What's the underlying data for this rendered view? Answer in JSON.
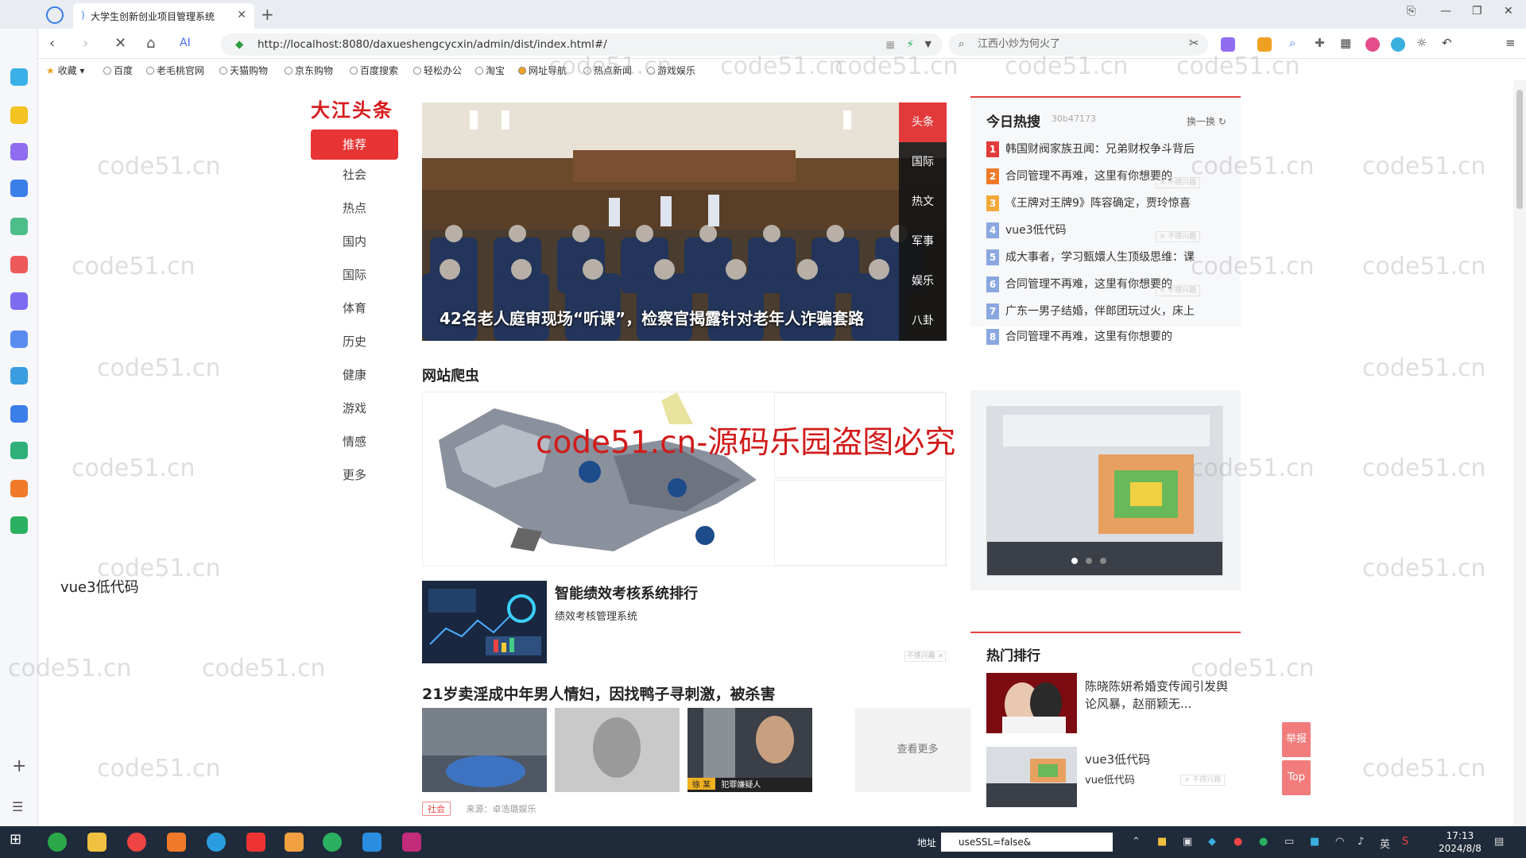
{
  "browser": {
    "tab_title": "大学生创新创业项目管理系统",
    "url": "http://localhost:8080/daxueshengcycxin/admin/dist/index.html#/",
    "search_placeholder": "江西小炒为何火了",
    "bookmarks": [
      "收藏",
      "百度",
      "老毛桃官网",
      "天猫购物",
      "京东购物",
      "百度搜索",
      "轻松办公",
      "淘宝",
      "网址导航",
      "热点新闻",
      "游戏娱乐"
    ]
  },
  "site": {
    "logo": "大江头条",
    "channels": [
      "推荐",
      "社会",
      "热点",
      "国内",
      "国际",
      "体育",
      "历史",
      "健康",
      "游戏",
      "情感",
      "更多"
    ]
  },
  "carousel": {
    "caption": "42名老人庭审现场“听课”，检察官揭露针对老年人诈骗套路",
    "tabs": [
      "头条",
      "国际",
      "热文",
      "军事",
      "娱乐",
      "八卦"
    ]
  },
  "section_title": "网站爬虫",
  "articles": [
    {
      "title": "智能绩效考核系统排行",
      "desc": "绩效考核管理系统",
      "close_label": "不感兴趣 ×"
    },
    {
      "title": "21岁卖淫成中年男人情妇，因找鸭子寻刺激，被杀害",
      "see_more": "查看更多",
      "tag": "社会",
      "source": "来源：卓浩璐娱乐",
      "img_caption": "犯罪嫌疑人",
      "img_name": "徐 某"
    }
  ],
  "hot": {
    "title": "今日热搜",
    "sub": "30b47173",
    "refresh": "换一换",
    "items": [
      {
        "num": "1",
        "text": "韩国财阀家族丑闻：兄弟财权争斗背后",
        "color": "#e33b3b"
      },
      {
        "num": "2",
        "text": "合同管理不再难，这里有你想要的",
        "color": "#f07a2a"
      },
      {
        "num": "3",
        "text": "《王牌对王牌9》阵容确定，贾玲惊喜",
        "color": "#f3a93a"
      },
      {
        "num": "4",
        "text": "vue3低代码",
        "color": "#8aa7e0"
      },
      {
        "num": "5",
        "text": "成大事者，学习甄嬛人生顶级思维：课",
        "color": "#8aa7e0"
      },
      {
        "num": "6",
        "text": "合同管理不再难，这里有你想要的",
        "color": "#8aa7e0"
      },
      {
        "num": "7",
        "text": "广东一男子结婚，伴郎团玩过火，床上",
        "color": "#8aa7e0"
      },
      {
        "num": "8",
        "text": "合同管理不再难，这里有你想要的",
        "color": "#8aa7e0"
      }
    ]
  },
  "promo": {
    "caption": "vue3低代码"
  },
  "rank": {
    "title": "热门排行",
    "item1": "陈晓陈妍希婚变传闻引发舆论风暴，赵丽颖无...",
    "item2_title": "vue3低代码",
    "item2_sub": "vue低代码"
  },
  "float": {
    "report": "举报",
    "top": "Top"
  },
  "watermark": {
    "small": "code51.cn",
    "big": "code51.cn-源码乐园盗图必究"
  },
  "taskbar": {
    "addr_label": "地址",
    "addr_value": "useSSL=false&",
    "time": "17:13",
    "date": "2024/8/8",
    "ime": "英"
  }
}
